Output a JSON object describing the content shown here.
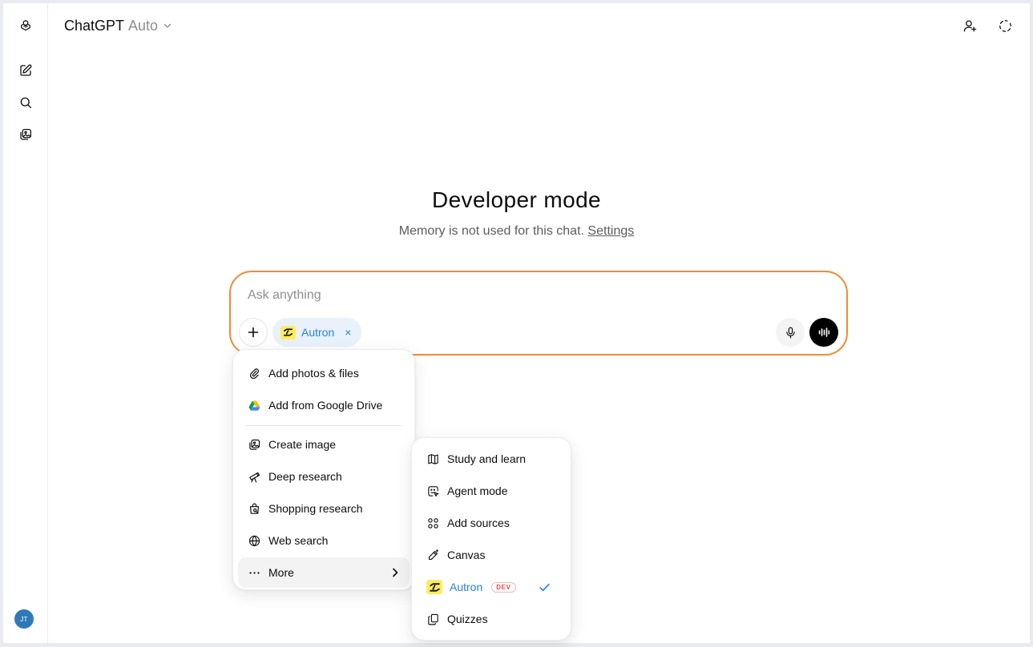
{
  "header": {
    "app_name": "ChatGPT",
    "model": "Auto",
    "icons": [
      "chevron-down-icon",
      "add-person-icon",
      "temporary-chat-icon"
    ]
  },
  "sidebar": {
    "icons": [
      "openai-logo-icon",
      "new-chat-icon",
      "search-icon",
      "images-icon"
    ],
    "avatar_initials": "JT"
  },
  "hero": {
    "title": "Developer mode",
    "subtitle": "Memory is not used for this chat.",
    "settings_link": "Settings"
  },
  "composer": {
    "placeholder": "Ask anything",
    "chip_label": "Autron",
    "chip_close": "×",
    "border_color": "#f08a3a"
  },
  "menu": {
    "items": [
      {
        "label": "Add photos & files",
        "icon": "paperclip-icon"
      },
      {
        "label": "Add from Google Drive",
        "icon": "google-drive-icon"
      },
      {
        "label": "Create image",
        "icon": "image-icon"
      },
      {
        "label": "Deep research",
        "icon": "telescope-icon"
      },
      {
        "label": "Shopping research",
        "icon": "shopping-bag-icon"
      },
      {
        "label": "Web search",
        "icon": "globe-icon"
      },
      {
        "label": "More",
        "icon": "more-icon"
      }
    ]
  },
  "submenu": {
    "items": [
      {
        "label": "Study and learn",
        "icon": "book-icon"
      },
      {
        "label": "Agent mode",
        "icon": "agent-icon"
      },
      {
        "label": "Add sources",
        "icon": "sources-icon"
      },
      {
        "label": "Canvas",
        "icon": "canvas-pen-icon"
      },
      {
        "label": "Autron",
        "icon": "autron-logo-icon",
        "badge": "DEV",
        "selected": true
      },
      {
        "label": "Quizzes",
        "icon": "quizzes-icon"
      }
    ]
  },
  "colors": {
    "accent_blue": "#2383e2",
    "composer_border": "#f08a3a",
    "autron_yellow": "#ffec5c",
    "dev_badge_red": "#e5484d"
  }
}
